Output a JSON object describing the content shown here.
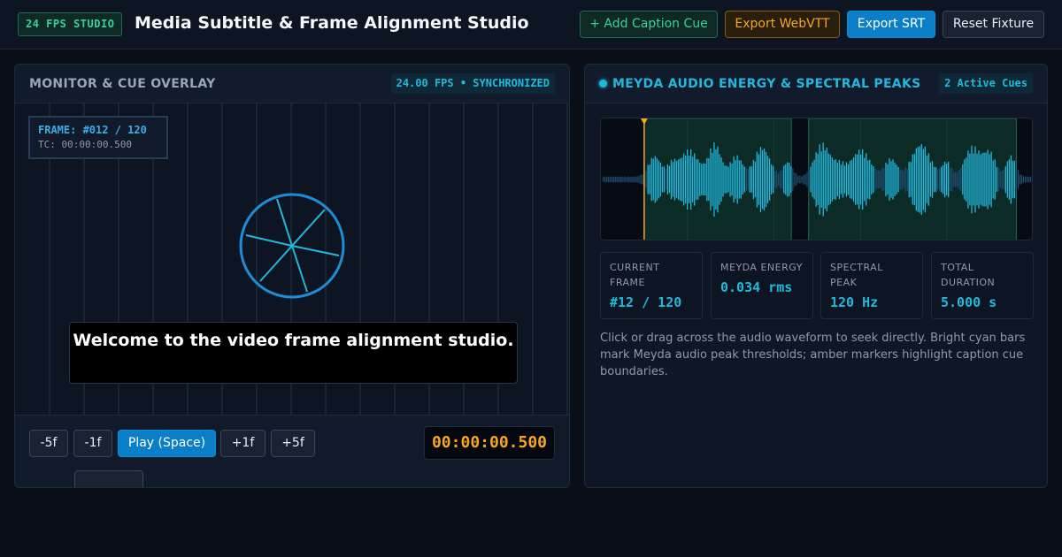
{
  "header": {
    "fps_badge": "24 FPS STUDIO",
    "title": "Media Subtitle & Frame Alignment Studio",
    "add_cue_label": "+ Add Caption Cue",
    "export_vtt_label": "Export WebVTT",
    "export_srt_label": "Export SRT",
    "reset_label": "Reset Fixture"
  },
  "monitor": {
    "title": "MONITOR & CUE OVERLAY",
    "sync_badge": "24.00 FPS • SYNCHRONIZED",
    "frame_text": "FRAME: #012 / 120",
    "timecode_text": "TC: 00:00:00.500",
    "caption": "Welcome to the video frame alignment studio."
  },
  "controls": {
    "minus5": "-5f",
    "minus1": "-1f",
    "play": "Play (Space)",
    "plus1": "+1f",
    "plus5": "+5f",
    "timecode": "00:00:00.500"
  },
  "energy": {
    "title": "MEYDA AUDIO ENERGY & SPECTRAL PEAKS",
    "cues_badge": "2 Active Cues",
    "playhead_fraction": 0.1,
    "cue_regions": [
      [
        0.1,
        0.44
      ],
      [
        0.48,
        0.96
      ]
    ],
    "stats": [
      {
        "label": "CURRENT FRAME",
        "value": "#12 / 120"
      },
      {
        "label": "MEYDA ENERGY",
        "value": "0.034 rms"
      },
      {
        "label": "SPECTRAL PEAK",
        "value": "120 Hz"
      },
      {
        "label": "TOTAL DURATION",
        "value": "5.000 s"
      }
    ],
    "help_text": "Click or drag across the audio waveform to seek directly. Bright cyan bars mark Meyda audio peak thresholds; amber markers highlight caption cue boundaries."
  },
  "colors": {
    "accent_cyan": "#22b8dc",
    "accent_amber": "#f5a623",
    "accent_green": "#34d399",
    "primary_blue": "#0a7fc7"
  },
  "icons": {
    "status_dot": "status-dot-icon",
    "playhead": "playhead-marker-icon",
    "wheel": "film-wheel-icon"
  }
}
